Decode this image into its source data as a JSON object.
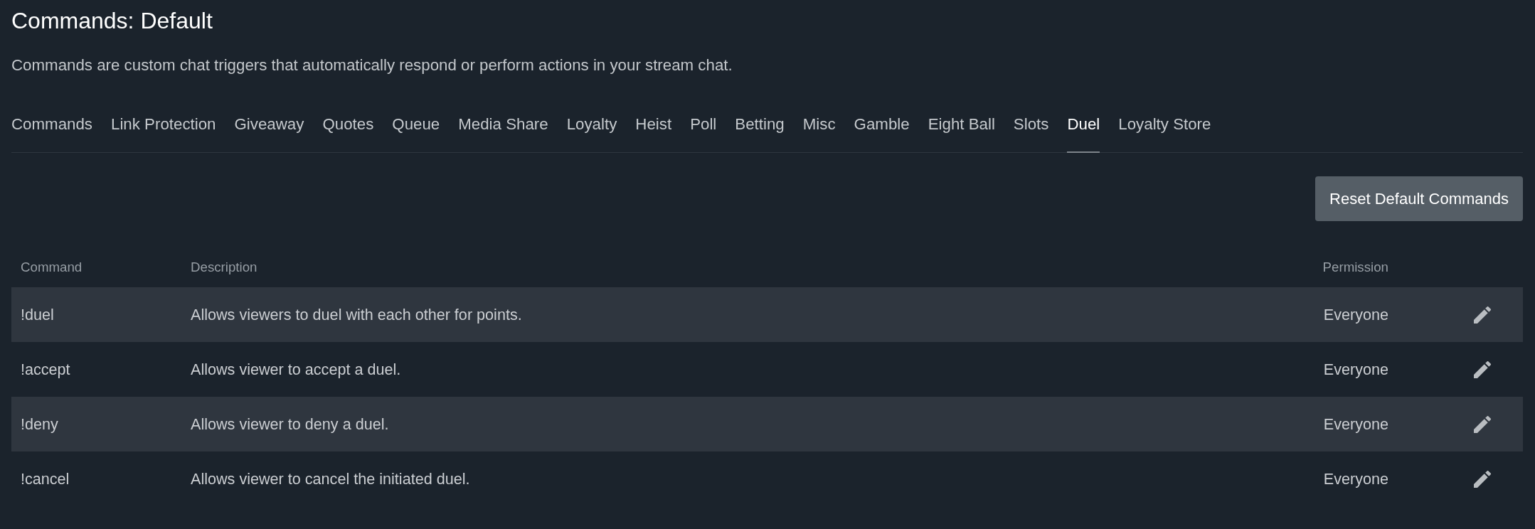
{
  "page": {
    "title": "Commands: Default",
    "description": "Commands are custom chat triggers that automatically respond or perform actions in your stream chat."
  },
  "tabs": [
    {
      "label": "Commands",
      "selected": false
    },
    {
      "label": "Link Protection",
      "selected": false
    },
    {
      "label": "Giveaway",
      "selected": false
    },
    {
      "label": "Quotes",
      "selected": false
    },
    {
      "label": "Queue",
      "selected": false
    },
    {
      "label": "Media Share",
      "selected": false
    },
    {
      "label": "Loyalty",
      "selected": false
    },
    {
      "label": "Heist",
      "selected": false
    },
    {
      "label": "Poll",
      "selected": false
    },
    {
      "label": "Betting",
      "selected": false
    },
    {
      "label": "Misc",
      "selected": false
    },
    {
      "label": "Gamble",
      "selected": false
    },
    {
      "label": "Eight Ball",
      "selected": false
    },
    {
      "label": "Slots",
      "selected": false
    },
    {
      "label": "Duel",
      "selected": true
    },
    {
      "label": "Loyalty Store",
      "selected": false
    }
  ],
  "toolbar": {
    "reset_button": "Reset Default Commands"
  },
  "table": {
    "columns": [
      "Command",
      "Description",
      "Permission"
    ],
    "rows": [
      {
        "command": "!duel",
        "description": "Allows viewers to duel with each other for points.",
        "permission": "Everyone"
      },
      {
        "command": "!accept",
        "description": "Allows viewer to accept a duel.",
        "permission": "Everyone"
      },
      {
        "command": "!deny",
        "description": "Allows viewer to deny a duel.",
        "permission": "Everyone"
      },
      {
        "command": "!cancel",
        "description": "Allows viewer to cancel the initiated duel.",
        "permission": "Everyone"
      }
    ]
  }
}
